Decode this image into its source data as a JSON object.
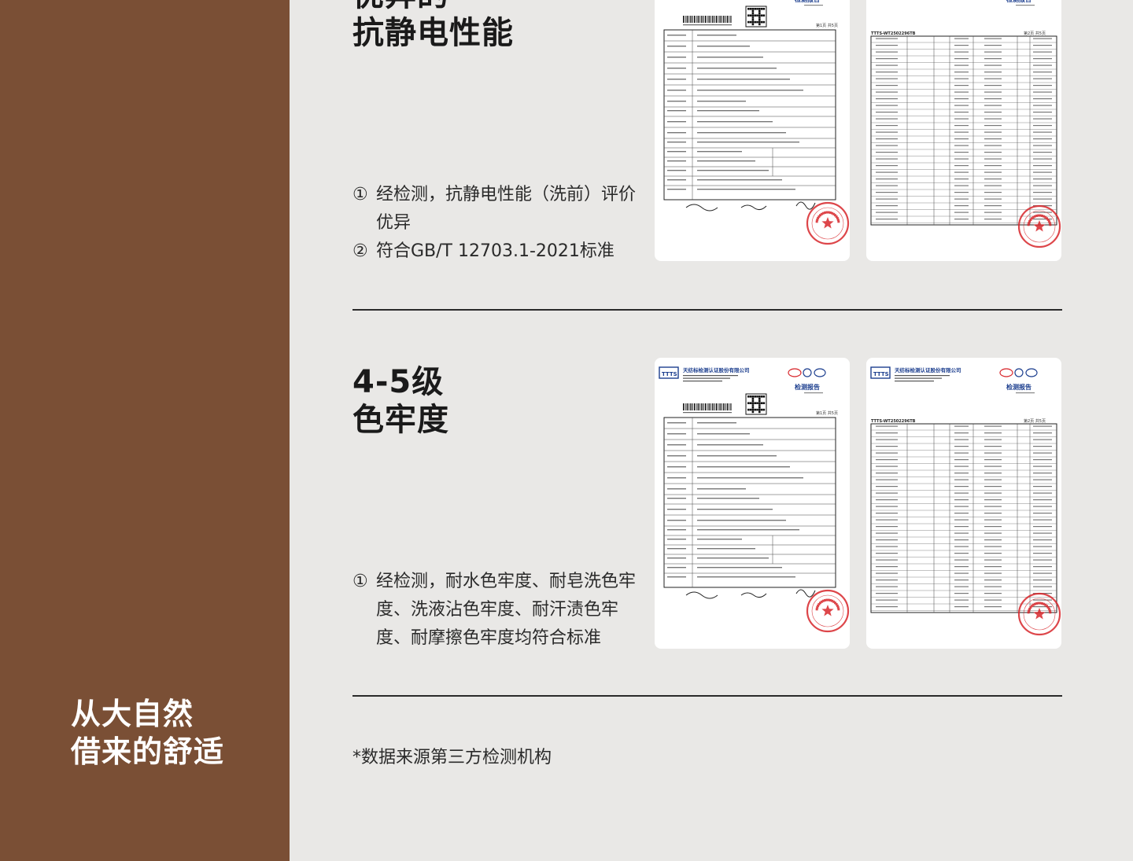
{
  "sidebar": {
    "slogan_line1": "从大自然",
    "slogan_line2": "借来的舒适",
    "bg_color": "#7a4f35"
  },
  "section1": {
    "heading_line1": "抗静电性能",
    "heading_partial": "优异的",
    "items": [
      {
        "num": "①",
        "text": "经检测，抗静电性能（洗前）评价优异"
      },
      {
        "num": "②",
        "text": "符合GB/T 12703.1-2021标准"
      }
    ]
  },
  "section2": {
    "heading_line1": "4-5级",
    "heading_line2": "色牢度",
    "items": [
      {
        "num": "①",
        "text": "经检测，耐水色牢度、耐皂洗色牢度、洗液沾色牢度、耐汗渍色牢度、耐摩擦色牢度均符合标准"
      }
    ]
  },
  "reports": {
    "org_name": "天纺标检测认证股份有限公司",
    "report_title": "检测报告",
    "logo_text": "TTTS",
    "report_no": "TTTS-WT2502296TB",
    "page1": "第1页 共5页",
    "page2": "第2页 共5页",
    "seal_color": "#d8262b"
  },
  "footnote": "*数据来源第三方检测机构"
}
